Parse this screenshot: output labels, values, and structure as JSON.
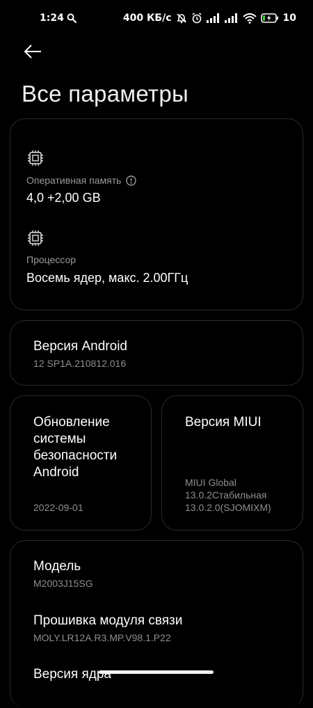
{
  "status_bar": {
    "time": "1:24",
    "network_speed": "400 КБ/с",
    "battery": "10",
    "icons": [
      "search-icon",
      "dnd-off-icon",
      "alarm-icon",
      "signal-icon",
      "wifi-icon",
      "battery-charging-icon"
    ]
  },
  "header": {
    "title": "Все параметры"
  },
  "specs": {
    "ram_label": "Оперативная память",
    "ram_value": "4,0 +2,00 GB",
    "cpu_label": "Процессор",
    "cpu_value": "Восемь ядер, макс. 2.00ГГц"
  },
  "android_version": {
    "title": "Версия Android",
    "value": "12 SP1A.210812.016"
  },
  "security_update": {
    "title_lines": [
      "Обновление",
      "системы",
      "безопасности",
      "Android"
    ],
    "value": "2022-09-01"
  },
  "miui_version": {
    "title": "Версия MIUI",
    "value_lines": [
      "MIUI Global",
      "13.0.2Стабильная",
      "13.0.2.0(SJOMIXM)"
    ]
  },
  "details": {
    "model_title": "Модель",
    "model_value": "M2003J15SG",
    "baseband_title": "Прошивка модуля связи",
    "baseband_value": "MOLY.LR12A.R3.MP.V98.1.P22",
    "kernel_title": "Версия ядра"
  },
  "colors": {
    "background": "#000000",
    "card_border": "#2a2a2a",
    "secondary_text": "#9a9a9a"
  }
}
